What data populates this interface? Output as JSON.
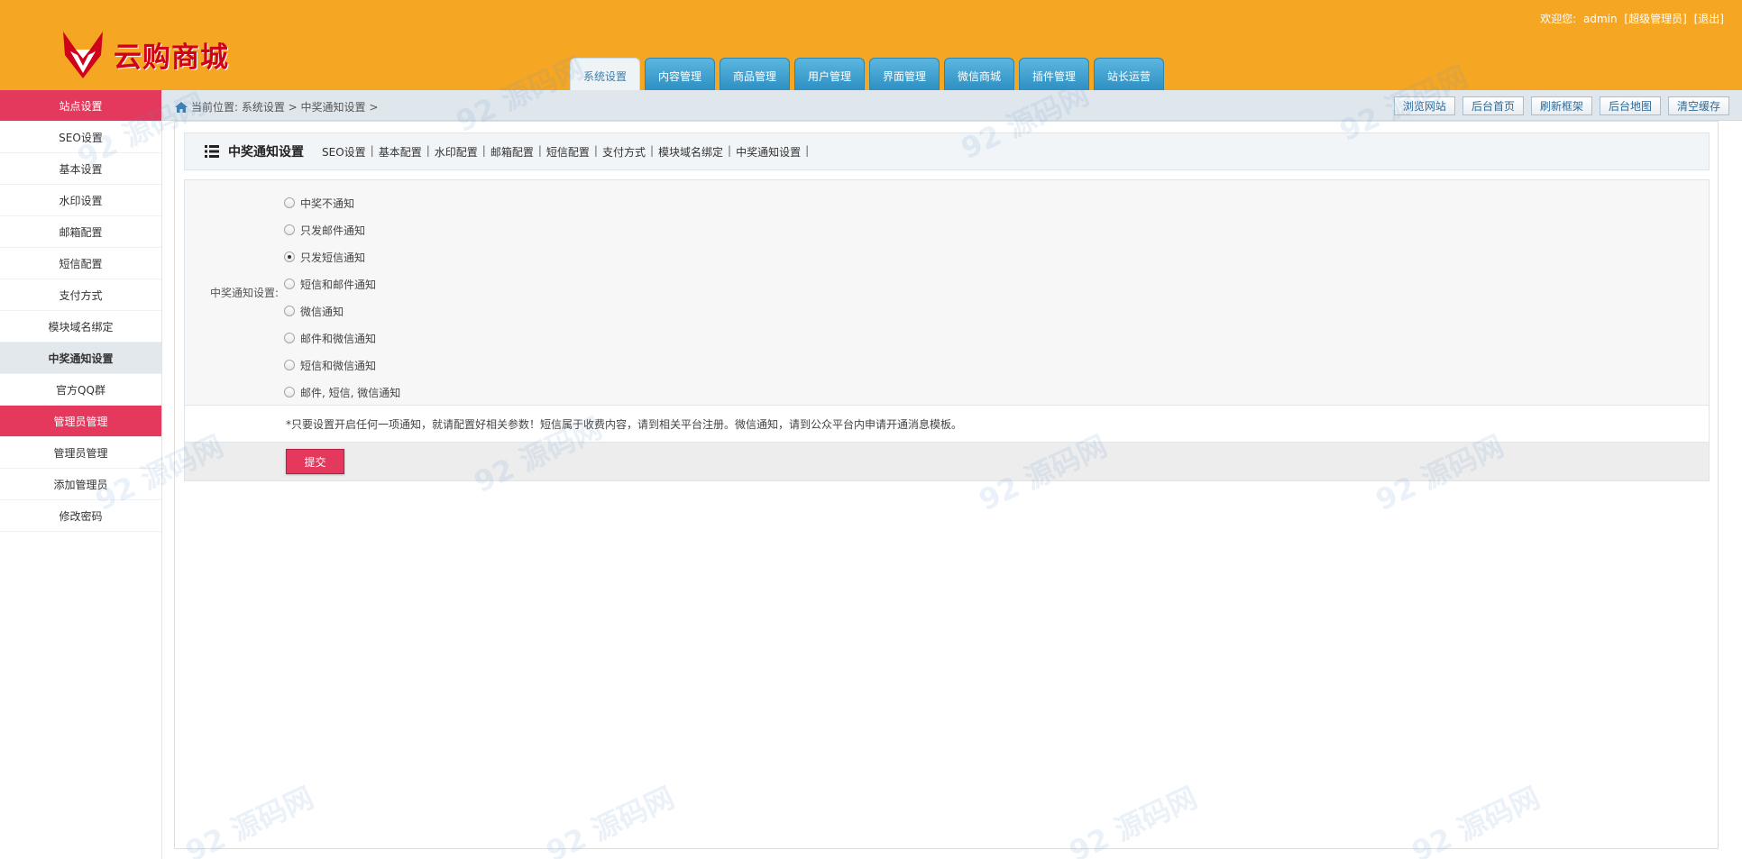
{
  "header": {
    "logo_text": "云购商城",
    "welcome_prefix": "欢迎您:",
    "username": "admin",
    "role": "[超级管理员]",
    "logout": "[退出]",
    "nav_tabs": [
      {
        "label": "系统设置",
        "active": true
      },
      {
        "label": "内容管理"
      },
      {
        "label": "商品管理"
      },
      {
        "label": "用户管理"
      },
      {
        "label": "界面管理"
      },
      {
        "label": "微信商城"
      },
      {
        "label": "插件管理"
      },
      {
        "label": "站长运营"
      }
    ],
    "colors": {
      "bar": "#f5a623",
      "tab": "#2d8fc3",
      "brand": "#d0021b"
    }
  },
  "sidebar": {
    "items": [
      {
        "label": "站点设置",
        "type": "head"
      },
      {
        "label": "SEO设置"
      },
      {
        "label": "基本设置"
      },
      {
        "label": "水印设置"
      },
      {
        "label": "邮箱配置"
      },
      {
        "label": "短信配置"
      },
      {
        "label": "支付方式"
      },
      {
        "label": "模块域名绑定"
      },
      {
        "label": "中奖通知设置",
        "active": true
      },
      {
        "label": "官方QQ群"
      },
      {
        "label": "管理员管理",
        "type": "head"
      },
      {
        "label": "管理员管理"
      },
      {
        "label": "添加管理员"
      },
      {
        "label": "修改密码"
      }
    ],
    "accent": "#e4385c"
  },
  "breadcrumb": {
    "text": "当前位置: 系统设置 > 中奖通知设置 >"
  },
  "toolbar": {
    "buttons": [
      "浏览网站",
      "后台首页",
      "刷新框架",
      "后台地图",
      "清空缓存"
    ]
  },
  "main": {
    "title": "中奖通知设置",
    "sublinks": [
      "SEO设置",
      "基本配置",
      "水印配置",
      "邮箱配置",
      "短信配置",
      "支付方式",
      "模块域名绑定",
      "中奖通知设置"
    ],
    "field_label": "中奖通知设置:",
    "options": [
      {
        "label": "中奖不通知"
      },
      {
        "label": "只发邮件通知"
      },
      {
        "label": "只发短信通知",
        "checked": true
      },
      {
        "label": "短信和邮件通知"
      },
      {
        "label": "微信通知"
      },
      {
        "label": "邮件和微信通知"
      },
      {
        "label": "短信和微信通知"
      },
      {
        "label": "邮件, 短信, 微信通知"
      }
    ],
    "note": "*只要设置开启任何一项通知，就请配置好相关参数！短信属于收费内容，请到相关平台注册。微信通知，请到公众平台内申请开通消息模板。",
    "submit_label": "提交"
  }
}
